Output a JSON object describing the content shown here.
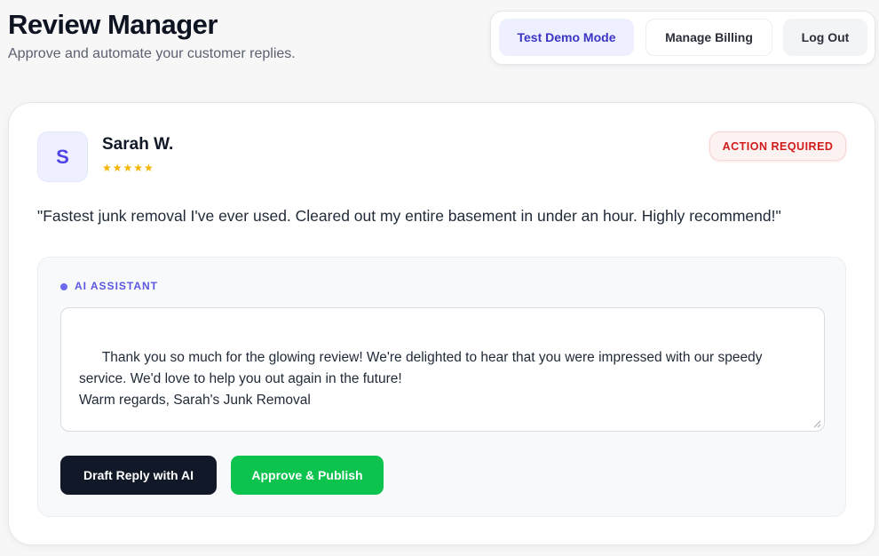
{
  "header": {
    "title": "Review Manager",
    "subtitle": "Approve and automate your customer replies."
  },
  "nav": {
    "demo_label": "Test Demo Mode",
    "billing_label": "Manage Billing",
    "logout_label": "Log Out"
  },
  "review": {
    "avatar_initial": "S",
    "reviewer_name": "Sarah W.",
    "rating": 5,
    "stars": "★★★★★",
    "status_badge": "ACTION REQUIRED",
    "text": "\"Fastest junk removal I've ever used. Cleared out my entire basement in under an hour. Highly recommend!\""
  },
  "ai_assistant": {
    "label": "AI ASSISTANT",
    "reply_text": "Thank you so much for the glowing review! We're delighted to hear that you were impressed with our speedy service. We'd love to help you out again in the future!\nWarm regards, Sarah's Junk Removal",
    "draft_button": "Draft Reply with AI",
    "approve_button": "Approve & Publish"
  },
  "colors": {
    "accent": "#4f46e5",
    "danger": "#d11a1a",
    "success": "#0bc34d",
    "dark": "#111827"
  }
}
